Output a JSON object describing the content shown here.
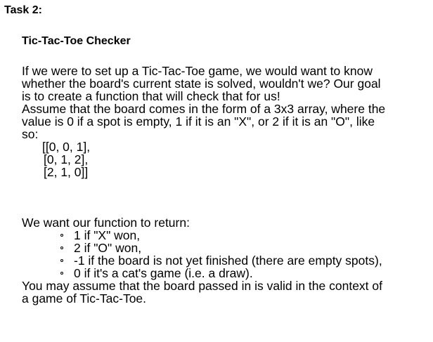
{
  "task_label": "Task 2:",
  "title": "Tic-Tac-Toe Checker",
  "intro_lines": [
    "If we were to set up a Tic-Tac-Toe game, we would want to know",
    "whether the board's current state is solved, wouldn't we? Our goal",
    "is to create a function that will check that for us!",
    "Assume that the board comes in the form of a 3x3 array, where the",
    "value is 0 if a spot is empty, 1 if it is an \"X\", or 2 if it is an \"O\", like",
    "so:"
  ],
  "board_example_lines": [
    "[[0, 0, 1],",
    "[0, 1, 2],",
    "[2, 1, 0]]"
  ],
  "return_intro": "We want our function to return:",
  "return_items": [
    "1 if \"X\" won,",
    "2 if \"O\" won,",
    "-1 if the board is not yet finished (there are empty spots),",
    "0 if it's a cat's game (i.e. a draw)."
  ],
  "closing_lines": [
    "You may assume that the board passed in is valid in the context of",
    "a game of Tic-Tac-Toe."
  ],
  "icons": {
    "bullet": "hollow-circle"
  }
}
